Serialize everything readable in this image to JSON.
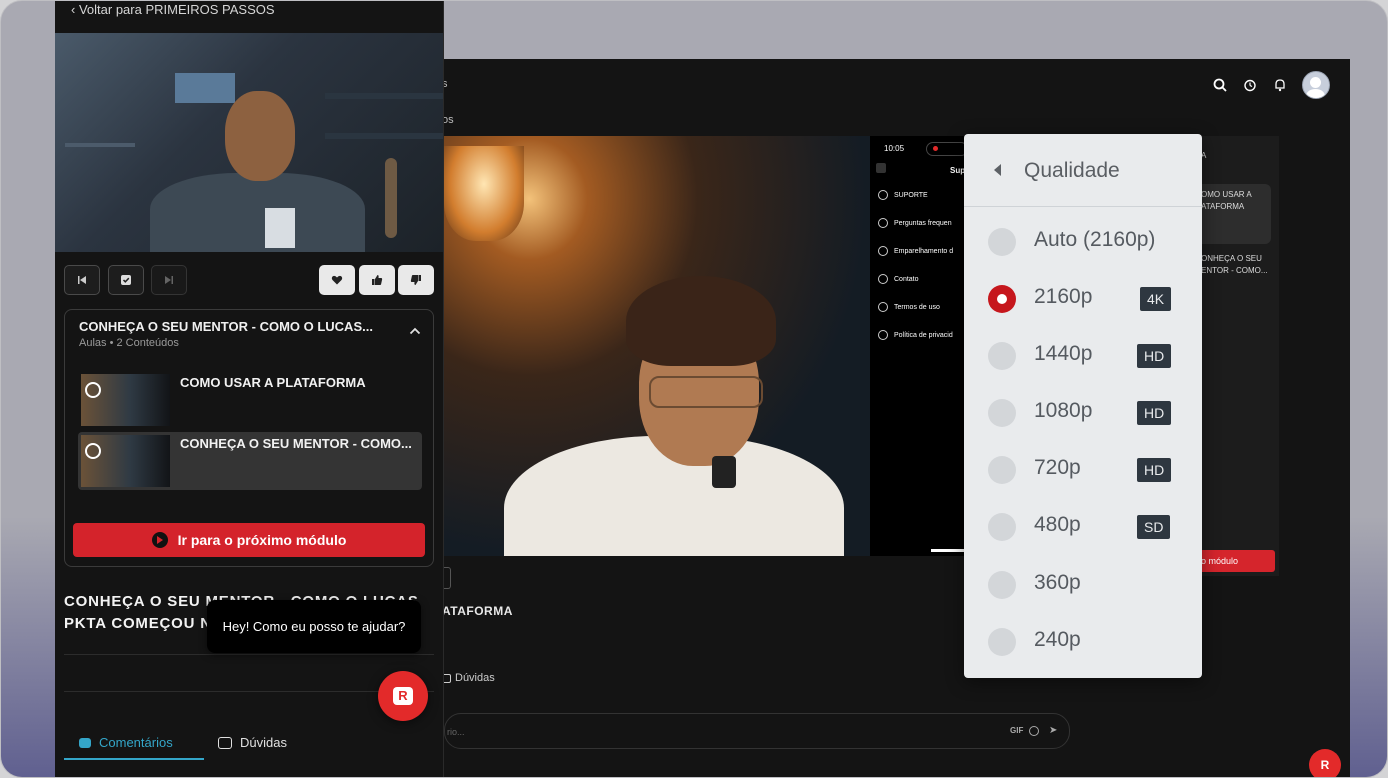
{
  "back_link": "Voltar para PRIMEIROS PASSOS",
  "module": {
    "title": "CONHEÇA O SEU MENTOR - COMO O LUCAS...",
    "subtitle": "Aulas • 2 Conteúdos",
    "lessons": [
      {
        "title": "COMO USAR A PLATAFORMA",
        "active": false
      },
      {
        "title": "CONHEÇA O SEU MENTOR - COMO...",
        "active": true
      }
    ],
    "next_button": "Ir para o próximo módulo"
  },
  "page_title": "CONHEÇA O SEU MENTOR - COMO O LUCAS PKTA COMEÇOU N",
  "tabs": [
    {
      "label": "Comentários",
      "active": true,
      "color": "#34a6c9"
    },
    {
      "label": "Dúvidas",
      "active": false
    }
  ],
  "chat": {
    "bubble": "Hey! Como eu posso te ajudar?",
    "fab_letter": "R"
  },
  "background": {
    "phone_time": "10:05",
    "phone_title": "Sup",
    "phone_menu": [
      "SUPORTE",
      "Perguntas frequen",
      "Emparelhamento d",
      "Contato",
      "Termos de uso",
      "Política de privacid"
    ],
    "right_panel": [
      "A",
      "OMO USAR A",
      "ATAFORMA",
      "ONHEÇA O SEU",
      "ENTOR - COMO..."
    ],
    "right_button": "o módulo",
    "lower_title": "ATAFORMA",
    "lower_doubts": "Dúvidas",
    "input_placeholder": "rio...",
    "gif_label": "GIF",
    "frag_top1": "s",
    "frag_top2": "os"
  },
  "quality_menu": {
    "title": "Qualidade",
    "options": [
      {
        "label": "Auto (2160p)",
        "badge": "",
        "selected": false
      },
      {
        "label": "2160p",
        "badge": "4K",
        "selected": true
      },
      {
        "label": "1440p",
        "badge": "HD",
        "selected": false
      },
      {
        "label": "1080p",
        "badge": "HD",
        "selected": false
      },
      {
        "label": "720p",
        "badge": "HD",
        "selected": false
      },
      {
        "label": "480p",
        "badge": "SD",
        "selected": false
      },
      {
        "label": "360p",
        "badge": "",
        "selected": false
      },
      {
        "label": "240p",
        "badge": "",
        "selected": false
      }
    ],
    "accent": "#c6171d"
  }
}
